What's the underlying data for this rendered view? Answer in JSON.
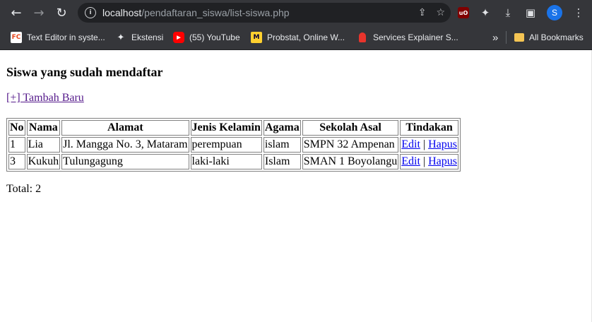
{
  "browser": {
    "url_host": "localhost",
    "url_path": "/pendaftaran_siswa/list-siswa.php",
    "profile_initial": "S",
    "bookmarks": [
      {
        "label": "Text Editor in syste...",
        "icon": "fc-icon"
      },
      {
        "label": "Ekstensi",
        "icon": "puzzle-icon"
      },
      {
        "label": "(55) YouTube",
        "icon": "youtube-icon"
      },
      {
        "label": "Probstat, Online W...",
        "icon": "miro-icon"
      },
      {
        "label": "Services Explainer S...",
        "icon": "services-icon"
      }
    ],
    "overflow_label": "»",
    "all_bookmarks_label": "All Bookmarks"
  },
  "page": {
    "heading": "Siswa yang sudah mendaftar",
    "add_link": "[+] Tambah Baru",
    "table": {
      "headers": [
        "No",
        "Nama",
        "Alamat",
        "Jenis Kelamin",
        "Agama",
        "Sekolah Asal",
        "Tindakan"
      ],
      "rows": [
        {
          "no": "1",
          "nama": "Lia",
          "alamat": "Jl. Mangga No. 3, Mataram",
          "jenis_kelamin": "perempuan",
          "agama": "islam",
          "sekolah_asal": "SMPN 32 Ampenan",
          "edit": "Edit",
          "sep": " | ",
          "hapus": "Hapus"
        },
        {
          "no": "3",
          "nama": "Kukuh",
          "alamat": "Tulungagung",
          "jenis_kelamin": "laki-laki",
          "agama": "Islam",
          "sekolah_asal": "SMAN 1 Boyolangu",
          "edit": "Edit",
          "sep": " | ",
          "hapus": "Hapus"
        }
      ]
    },
    "total": "Total: 2"
  }
}
